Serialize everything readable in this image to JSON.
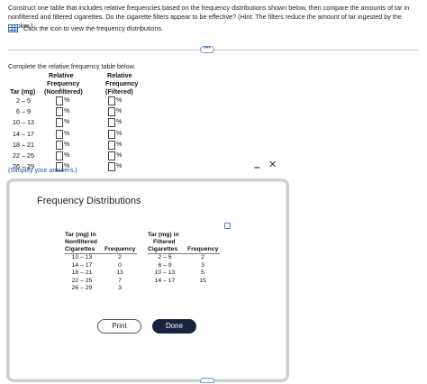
{
  "instructions": "Construct one table that includes relative frequencies based on the frequency distributions shown below, then compare the amounts of tar in nonfiltered and filtered cigarettes. Do the cigarette filters appear to be effective? (Hint: The filters reduce the amount of tar ingested by the smoker.)",
  "hint": {
    "icon": "table-icon",
    "text": "Click the icon to view the frequency distributions."
  },
  "more_button": "•••",
  "task": "Complete the relative frequency table below.",
  "rf_table": {
    "col1_header": "Tar (mg)",
    "col2_header_l1": "Relative",
    "col2_header_l2": "Frequency",
    "col2_header_l3": "(Nonfiltered)",
    "col3_header_l1": "Relative",
    "col3_header_l2": "Frequency",
    "col3_header_l3": "(Filtered)",
    "percent": "%",
    "rows": [
      {
        "cls": "2 – 5"
      },
      {
        "cls": "6 – 9"
      },
      {
        "cls": "10 – 13"
      },
      {
        "cls": "14 – 17"
      },
      {
        "cls": "18 – 21"
      },
      {
        "cls": "22 – 25"
      },
      {
        "cls": "26 – 29"
      }
    ]
  },
  "simplify": "(Simplify your answers.)",
  "modal": {
    "title": "Frequency Distributions",
    "minimize": "–",
    "close": "✕",
    "nonfiltered": {
      "header_l1": "Tar (mg) in",
      "header_l2": "Nonfiltered",
      "header_l3": "Cigarettes",
      "freq_header": "Frequency",
      "classes": [
        "10 – 13",
        "14 – 17",
        "18 – 21",
        "22 – 25",
        "26 – 29"
      ],
      "freqs": [
        "2",
        "0",
        "13",
        "7",
        "3"
      ]
    },
    "filtered": {
      "header_l1": "Tar (mg) in",
      "header_l2": "Filtered",
      "header_l3": "Cigarettes",
      "freq_header": "Frequency",
      "classes": [
        "2 – 5",
        "6 – 9",
        "10 – 13",
        "14 – 17"
      ],
      "freqs": [
        "2",
        "3",
        "5",
        "15"
      ]
    },
    "print_label": "Print",
    "done_label": "Done"
  }
}
